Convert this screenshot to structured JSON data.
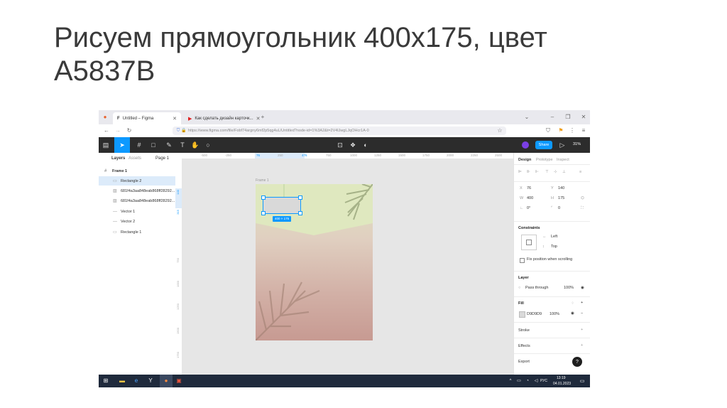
{
  "slide": {
    "title": "Рисуем прямоугольник 400х175, цвет\nA5837B"
  },
  "browser": {
    "tabs": [
      {
        "label": "Untitled – Figma"
      },
      {
        "label": "Как сделать дизайн карточк..."
      }
    ],
    "url": "https://www.figma.com/file/Fobf74argny6mf2p5qg4uL/Untitled?node-id=1%3A2&t=2V4lJwgLJqOHcr1A-0"
  },
  "figma": {
    "zoom": "31%",
    "share_label": "Share",
    "rulers": {
      "top": [
        "-500",
        "-250",
        "76",
        "250",
        "476",
        "750",
        "1000",
        "1250",
        "1500",
        "1750",
        "2000",
        "2250",
        "2500"
      ],
      "left": [
        "140",
        "315",
        "750",
        "1000",
        "1250",
        "1500",
        "1750"
      ]
    },
    "left_panel": {
      "tabs": [
        "Layers",
        "Assets"
      ],
      "page": "Page 1",
      "layers": [
        {
          "name": "Frame 1",
          "icon": "frame-icon"
        },
        {
          "name": "Rectangle 2",
          "icon": "rectangle-icon"
        },
        {
          "name": "681f4a3aa848eab868ff28292...",
          "icon": "image-icon"
        },
        {
          "name": "681f4a3aa848eab868ff28292...",
          "icon": "image-icon"
        },
        {
          "name": "Vector 1",
          "icon": "vector-icon"
        },
        {
          "name": "Vector 2",
          "icon": "vector-icon"
        },
        {
          "name": "Rectangle 1",
          "icon": "rectangle-icon"
        }
      ]
    },
    "canvas": {
      "frame_label": "Frame 1",
      "size_badge": "400 × 175"
    },
    "right_panel": {
      "tabs": [
        "Design",
        "Prototype",
        "Inspect"
      ],
      "x_label": "X",
      "x": "76",
      "y_label": "Y",
      "y": "140",
      "w_label": "W",
      "w": "400",
      "h_label": "H",
      "h": "175",
      "rotation": "0°",
      "radius": "0",
      "constraints_title": "Constraints",
      "constraint_h": "Left",
      "constraint_v": "Top",
      "fix_position": "Fix position when scrolling",
      "layer_title": "Layer",
      "blend": "Pass through",
      "layer_opacity": "100%",
      "fill_title": "Fill",
      "fill_hex": "D9D9D9",
      "fill_opacity": "100%",
      "fill_color": "#d9d9d9",
      "stroke_title": "Stroke",
      "effects_title": "Effects",
      "export_title": "Export"
    }
  },
  "taskbar": {
    "lang": "РУС",
    "time": "13:19",
    "date": "04.01.2023"
  }
}
